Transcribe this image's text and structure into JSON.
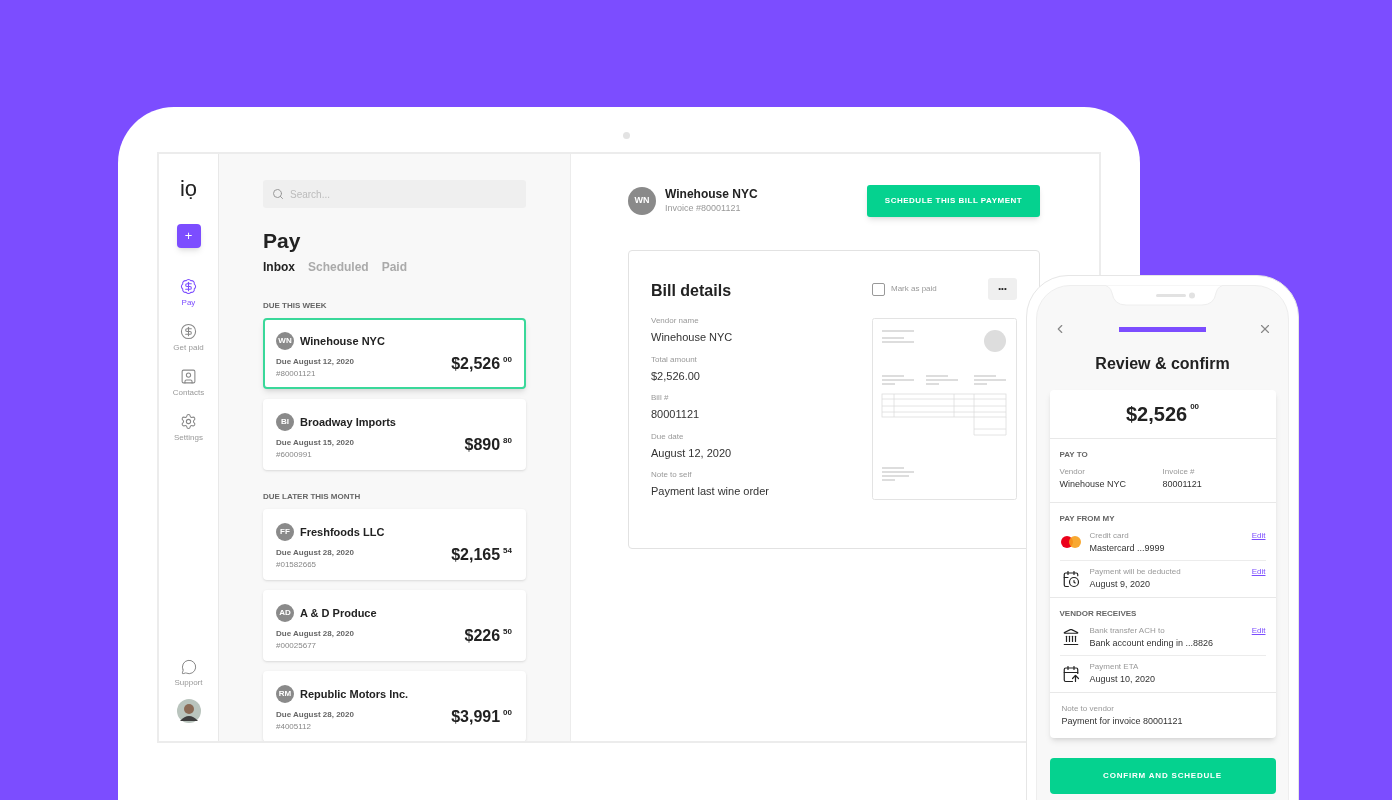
{
  "sidebar": {
    "logo": "iọ",
    "new_button": "+",
    "items": [
      {
        "kind": "pay",
        "label": "Pay",
        "selected": true
      },
      {
        "kind": "get-paid",
        "label": "Get paid",
        "selected": false
      },
      {
        "kind": "contacts",
        "label": "Contacts",
        "selected": false
      },
      {
        "kind": "settings",
        "label": "Settings",
        "selected": false
      }
    ],
    "support": "Support"
  },
  "bills": {
    "search": {
      "placeholder": "Search..."
    },
    "title": "Pay",
    "tabs": [
      {
        "label": "Inbox",
        "selected": true
      },
      {
        "label": "Scheduled",
        "selected": false
      },
      {
        "label": "Paid",
        "selected": false
      }
    ],
    "groups": [
      {
        "heading": "DUE THIS WEEK",
        "items": [
          {
            "initials": "WN",
            "vendor": "Winehouse NYC",
            "due": "Due August 12, 2020",
            "number": "#80001121",
            "amount": "$2,526",
            "cents": "00",
            "selected": true
          },
          {
            "initials": "BI",
            "vendor": "Broadway Imports",
            "due": "Due August 15, 2020",
            "number": "#6000991",
            "amount": "$890",
            "cents": "80",
            "selected": false
          }
        ]
      },
      {
        "heading": "DUE LATER THIS MONTH",
        "items": [
          {
            "initials": "FF",
            "vendor": "Freshfoods LLC",
            "due": "Due August 28, 2020",
            "number": "#01582665",
            "amount": "$2,165",
            "cents": "54",
            "selected": false
          },
          {
            "initials": "AD",
            "vendor": "A & D Produce",
            "due": "Due August 28, 2020",
            "number": "#00025677",
            "amount": "$226",
            "cents": "50",
            "selected": false
          },
          {
            "initials": "RM",
            "vendor": "Republic Motors Inc.",
            "due": "Due August 28, 2020",
            "number": "#4005112",
            "amount": "$3,991",
            "cents": "00",
            "selected": false
          }
        ]
      }
    ]
  },
  "detail": {
    "initials": "WN",
    "vendor": "Winehouse NYC",
    "invoice": "Invoice #80001121",
    "action": "SCHEDULE THIS BILL PAYMENT",
    "card": {
      "title": "Bill details",
      "mark_paid": {
        "label": "Mark as paid",
        "checked": false
      },
      "more": "•••",
      "fields": [
        {
          "label": "Vendor name",
          "value": "Winehouse NYC"
        },
        {
          "label": "Total amount",
          "value": "$2,526.00"
        },
        {
          "label": "Bill #",
          "value": "80001121"
        },
        {
          "label": "Due date",
          "value": "August 12, 2020"
        },
        {
          "label": "Note to self",
          "value": "Payment last wine order"
        }
      ]
    }
  },
  "phone": {
    "progress": {
      "level": 1
    },
    "title": "Review & confirm",
    "amount": "$2,526",
    "cents": "00",
    "pay_to": {
      "heading": "PAY TO",
      "fields": [
        {
          "label": "Vendor",
          "value": "Winehouse NYC"
        },
        {
          "label": "Invoice #",
          "value": "80001121"
        }
      ]
    },
    "sections": [
      {
        "heading": "PAY FROM MY",
        "rows": [
          {
            "kind": "mastercard",
            "label": "Credit card",
            "value": "Mastercard ...9999",
            "edit": "Edit"
          },
          {
            "kind": "calendar-clock",
            "label": "Payment will be deducted",
            "value": "August 9, 2020",
            "edit": "Edit"
          }
        ]
      },
      {
        "heading": "VENDOR RECEIVES",
        "rows": [
          {
            "kind": "bank",
            "label": "Bank transfer ACH to",
            "value": "Bank account ending in ...8826",
            "edit": "Edit"
          },
          {
            "kind": "calendar-arrow",
            "label": "Payment ETA",
            "value": "August 10, 2020"
          }
        ]
      }
    ],
    "note": {
      "label": "Note to vendor",
      "value": "Payment for invoice 80001121"
    },
    "button": "CONFIRM AND SCHEDULE"
  }
}
